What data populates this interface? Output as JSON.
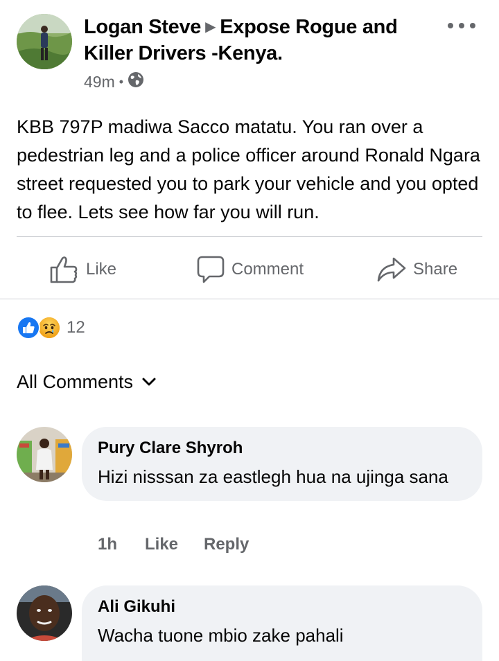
{
  "post": {
    "author": "Logan Steve",
    "group": "Expose Rogue and Killer Drivers -Kenya.",
    "time": "49m",
    "privacy_icon": "globe-icon",
    "text": "KBB 797P madiwa Sacco matatu. You ran over a pedestrian leg and a police officer around Ronald Ngara street requested you to park your vehicle and you opted to flee. Lets see how far you will run."
  },
  "actions": {
    "like_label": "Like",
    "comment_label": "Comment",
    "share_label": "Share"
  },
  "reactions": {
    "icons": [
      "like-reaction-icon",
      "sad-reaction-icon"
    ],
    "count": "12"
  },
  "comments_header": {
    "label": "All Comments",
    "icon": "chevron-down-icon"
  },
  "comments": [
    {
      "name": "Pury Clare Shyroh",
      "text": "Hizi nisssan za eastlegh hua na ujinga sana",
      "time": "1h",
      "like_label": "Like",
      "reply_label": "Reply"
    },
    {
      "name": "Ali Gikuhi",
      "text": "Wacha tuone mbio zake pahali"
    }
  ],
  "colors": {
    "primary_text": "#050505",
    "secondary_text": "#65676b",
    "bubble_bg": "#f0f2f5",
    "like_blue": "#1877f2",
    "divider": "#ced0d4"
  }
}
